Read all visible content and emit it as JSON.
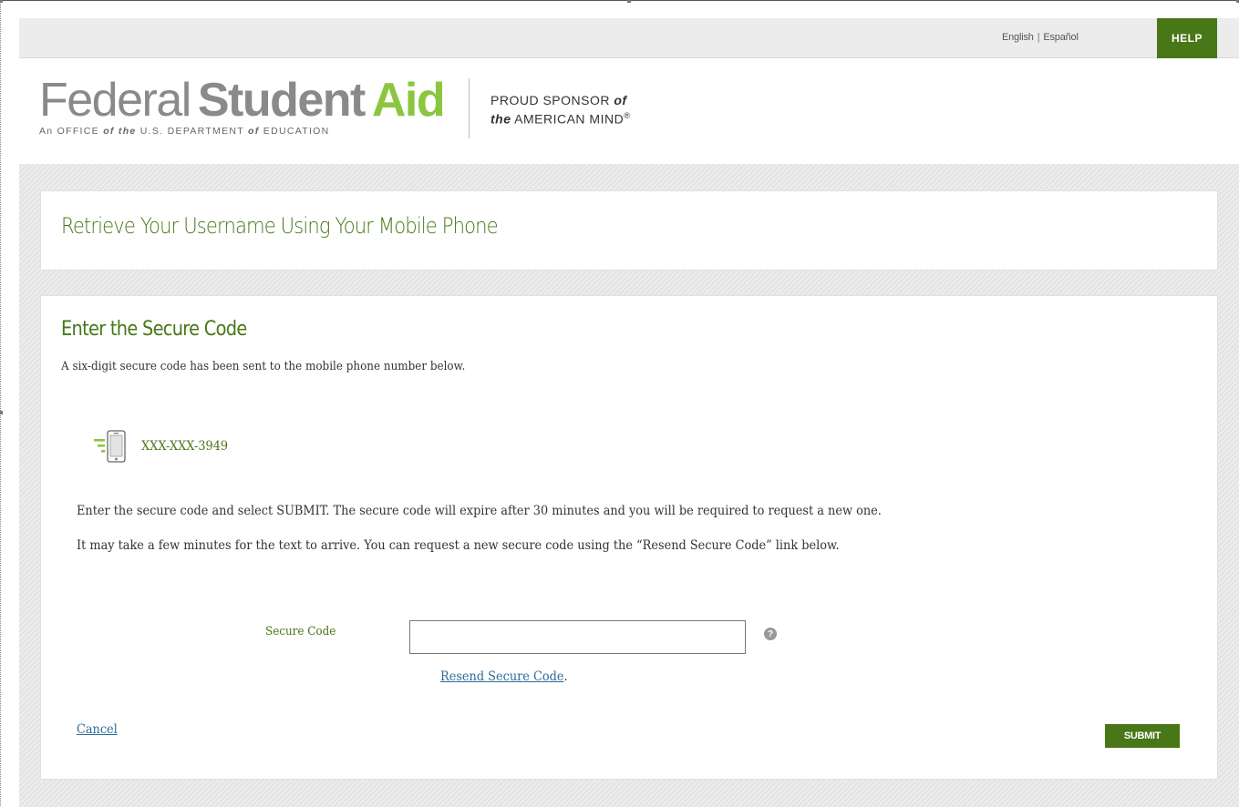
{
  "topbar": {
    "lang_english": "English",
    "lang_separator": "|",
    "lang_espanol": "Español",
    "help_label": "HELP"
  },
  "logo": {
    "word1": "Federal",
    "word2": "Student",
    "word3": "Aid",
    "sub_a": "An OFFICE ",
    "sub_of1": "of the",
    "sub_b": " U.S. DEPARTMENT ",
    "sub_of2": "of",
    "sub_c": " EDUCATION",
    "sponsor_line1": "PROUD SPONSOR ",
    "sponsor_of": "of",
    "sponsor_the": "the",
    "sponsor_line2": " AMERICAN MIND",
    "sponsor_reg": "®"
  },
  "page": {
    "title": "Retrieve Your Username Using Your Mobile Phone"
  },
  "main": {
    "section_title": "Enter the Secure Code",
    "intro": "A six-digit secure code has been sent to the mobile phone number below.",
    "phone_number": "XXX-XXX-3949",
    "instruction1": "Enter the secure code and select SUBMIT. The secure code will expire after 30 minutes and you will be required to request a new one.",
    "instruction2": "It may take a few minutes for the text to arrive. You can request a new secure code using the “Resend Secure Code” link below.",
    "code_label": "Secure Code",
    "code_value": "",
    "help_q": "?",
    "resend_link": "Resend Secure Code",
    "resend_period": ".",
    "cancel_link": "Cancel",
    "submit_label": "SUBMIT"
  },
  "colors": {
    "brand_green": "#487718",
    "logo_green": "#8cc63f",
    "link_blue": "#2f6a96"
  },
  "icons": {
    "phone": "mobile-phone-signal-icon",
    "help": "question-circle-icon"
  }
}
